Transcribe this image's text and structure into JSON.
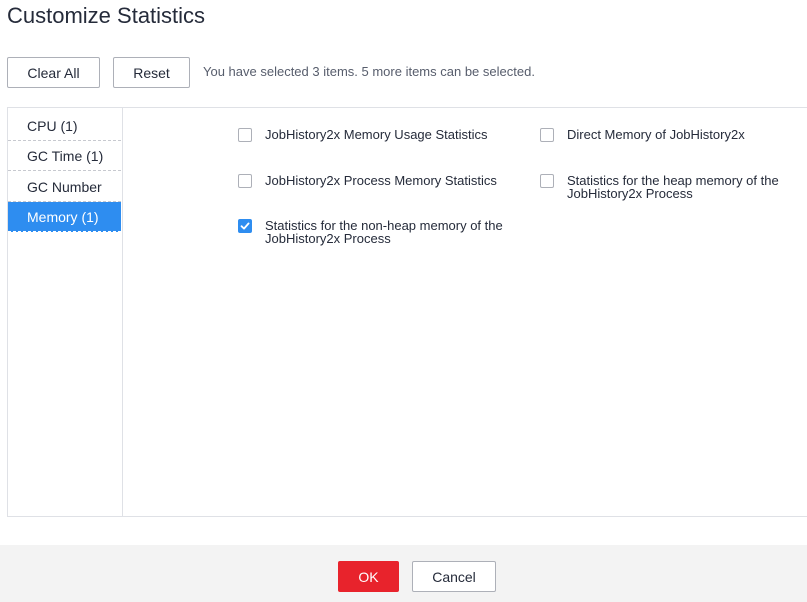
{
  "dialog": {
    "title": "Customize Statistics"
  },
  "toolbar": {
    "clear_all_label": "Clear All",
    "reset_label": "Reset",
    "selection_info": "You have selected 3 items. 5 more items can be selected."
  },
  "categories": [
    {
      "label": "CPU (1)",
      "active": false
    },
    {
      "label": "GC Time (1)",
      "active": false
    },
    {
      "label": "GC Number",
      "active": false
    },
    {
      "label": "Memory (1)",
      "active": true
    }
  ],
  "options": [
    {
      "label": "JobHistory2x Memory Usage Statistics",
      "checked": false
    },
    {
      "label": "JobHistory2x Process Memory Statistics",
      "checked": false
    },
    {
      "label": "Statistics for the non-heap memory of the JobHistory2x Process",
      "checked": true
    },
    {
      "label": "Direct Memory of JobHistory2x",
      "checked": false
    },
    {
      "label": "Statistics for the heap memory of the JobHistory2x Process",
      "checked": false
    }
  ],
  "footer": {
    "ok_label": "OK",
    "cancel_label": "Cancel"
  },
  "colors": {
    "accent": "#2e8df0",
    "primary_button": "#e8232c",
    "footer_bg": "#f3f3f3"
  },
  "icons": {
    "checked": "checkmark-icon"
  }
}
